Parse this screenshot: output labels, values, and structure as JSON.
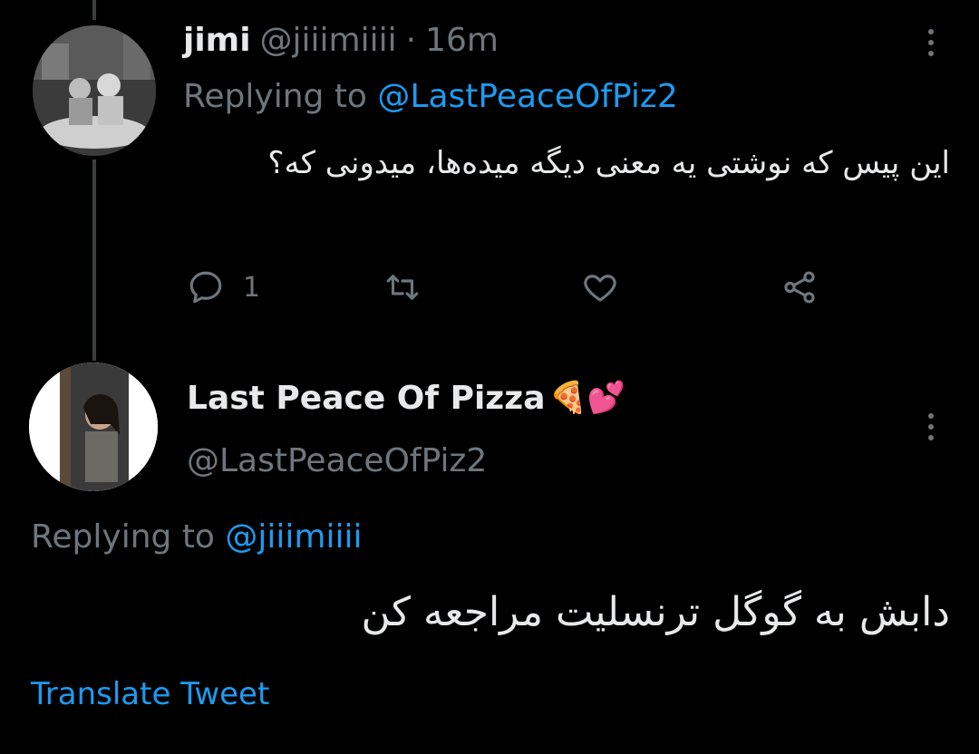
{
  "tweet1": {
    "display_name": "jimi",
    "handle": "@jiiimiiii",
    "separator": "·",
    "time": "16m",
    "replying_prefix": "Replying to",
    "replying_to": "@LastPeaceOfPiz2",
    "text": "این پیس که نوشتی یه معنی دیگه میده‌ها، میدونی که؟",
    "actions": {
      "reply_count": "1",
      "icons": [
        "reply-icon",
        "retweet-icon",
        "like-icon",
        "share-icon"
      ]
    }
  },
  "tweet2": {
    "display_name": "Last Peace Of Pizza",
    "name_emojis": "🍕💕",
    "handle": "@LastPeaceOfPiz2",
    "replying_prefix": "Replying to",
    "replying_to": "@jiiimiiii",
    "text": "دابش به گوگل ترنسلیت مراجعه کن",
    "translate_label": "Translate Tweet"
  },
  "colors": {
    "background": "#000000",
    "text": "#e7e9ea",
    "muted": "#6e767d",
    "accent": "#1d9bf0",
    "thread_line": "#3a3d40"
  }
}
